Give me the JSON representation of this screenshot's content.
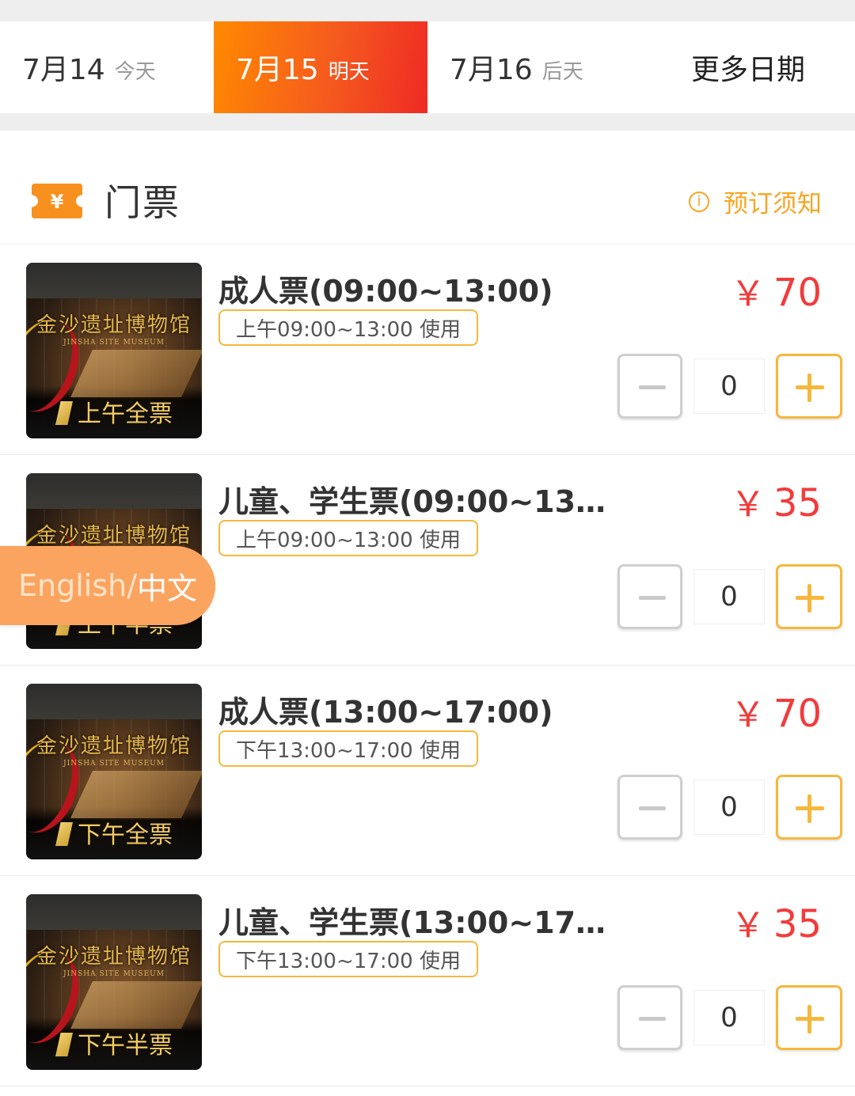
{
  "date_tabs": [
    {
      "date": "7月14",
      "sub": "今天"
    },
    {
      "date": "7月15",
      "sub": "明天"
    },
    {
      "date": "7月16",
      "sub": "后天"
    },
    {
      "date": "更多日期",
      "sub": ""
    }
  ],
  "active_date_index": 1,
  "section": {
    "title": "门票",
    "ticket_icon_glyph": "¥",
    "notice_label": "预订须知",
    "notice_icon_glyph": "i"
  },
  "ticket_image": {
    "museum_name": "金沙遗址博物馆",
    "museum_name_en": "JINSHA SITE MUSEUM"
  },
  "tickets": [
    {
      "name": "成人票(09:00~13:00)",
      "tag": "上午09:00~13:00 使用",
      "currency": "￥",
      "price": "70",
      "qty": "0",
      "image_caption": "上午全票"
    },
    {
      "name": "儿童、学生票(09:00~13…",
      "tag": "上午09:00~13:00 使用",
      "currency": "￥",
      "price": "35",
      "qty": "0",
      "image_caption": "上午半票"
    },
    {
      "name": "成人票(13:00~17:00)",
      "tag": "下午13:00~17:00 使用",
      "currency": "￥",
      "price": "70",
      "qty": "0",
      "image_caption": "下午全票"
    },
    {
      "name": "儿童、学生票(13:00~17…",
      "tag": "下午13:00~17:00 使用",
      "currency": "￥",
      "price": "35",
      "qty": "0",
      "image_caption": "下午半票"
    }
  ],
  "language_toggle": {
    "en": "English/",
    "zh": "中文"
  },
  "colors": {
    "accent": "#f5a623",
    "price": "#f23b3b",
    "active_tab_start": "#ff8a00",
    "active_tab_end": "#ee2a24",
    "lang_toggle_bg": "#fba460"
  }
}
